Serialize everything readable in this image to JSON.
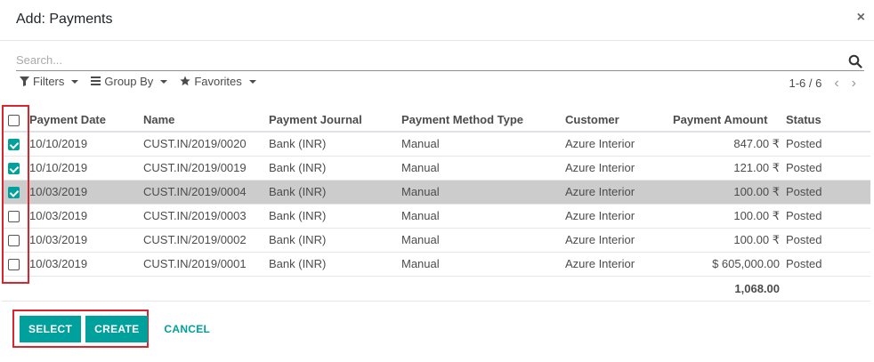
{
  "dialog": {
    "title": "Add: Payments",
    "close_symbol": "×"
  },
  "search": {
    "placeholder": "Search..."
  },
  "filters": {
    "filters_label": "Filters",
    "groupby_label": "Group By",
    "favorites_label": "Favorites"
  },
  "pager": {
    "value": "1-6 / 6",
    "prev_symbol": "‹",
    "next_symbol": "›"
  },
  "table": {
    "columns": [
      "Payment Date",
      "Name",
      "Payment Journal",
      "Payment Method Type",
      "Customer",
      "Payment Amount",
      "Status"
    ],
    "rows": [
      {
        "checked": true,
        "selected": false,
        "date": "10/10/2019",
        "name": "CUST.IN/2019/0020",
        "journal": "Bank (INR)",
        "method": "Manual",
        "customer": "Azure Interior",
        "amount": "847.00 ₹",
        "status": "Posted"
      },
      {
        "checked": true,
        "selected": false,
        "date": "10/10/2019",
        "name": "CUST.IN/2019/0019",
        "journal": "Bank (INR)",
        "method": "Manual",
        "customer": "Azure Interior",
        "amount": "121.00 ₹",
        "status": "Posted"
      },
      {
        "checked": true,
        "selected": true,
        "date": "10/03/2019",
        "name": "CUST.IN/2019/0004",
        "journal": "Bank (INR)",
        "method": "Manual",
        "customer": "Azure Interior",
        "amount": "100.00 ₹",
        "status": "Posted"
      },
      {
        "checked": false,
        "selected": false,
        "date": "10/03/2019",
        "name": "CUST.IN/2019/0003",
        "journal": "Bank (INR)",
        "method": "Manual",
        "customer": "Azure Interior",
        "amount": "100.00 ₹",
        "status": "Posted"
      },
      {
        "checked": false,
        "selected": false,
        "date": "10/03/2019",
        "name": "CUST.IN/2019/0002",
        "journal": "Bank (INR)",
        "method": "Manual",
        "customer": "Azure Interior",
        "amount": "100.00 ₹",
        "status": "Posted"
      },
      {
        "checked": false,
        "selected": false,
        "date": "10/03/2019",
        "name": "CUST.IN/2019/0001",
        "journal": "Bank (INR)",
        "method": "Manual",
        "customer": "Azure Interior",
        "amount": "$ 605,000.00",
        "status": "Posted"
      }
    ],
    "total": "1,068.00"
  },
  "footer": {
    "select_label": "SELECT",
    "create_label": "CREATE",
    "cancel_label": "CANCEL"
  },
  "colors": {
    "accent": "#00a09d",
    "highlight": "#d9262e",
    "selected_row": "#cccccc"
  }
}
